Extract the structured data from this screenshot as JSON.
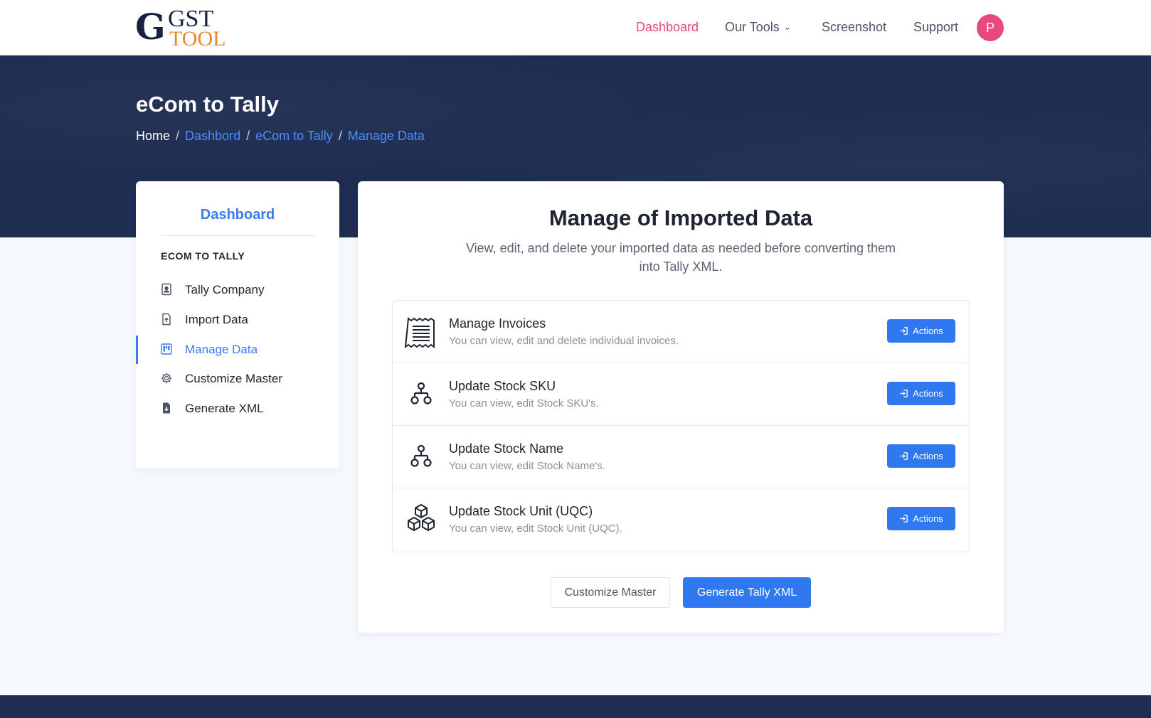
{
  "brand": {
    "logo_mark": "G",
    "logo_top": "GST",
    "logo_bottom": "TOOL"
  },
  "nav": {
    "dashboard": "Dashboard",
    "our_tools": "Our Tools",
    "screenshot": "Screenshot",
    "support": "Support",
    "avatar_initial": "P"
  },
  "hero": {
    "title": "eCom to Tally",
    "breadcrumb": [
      "Home",
      "Dashbord",
      "eCom to Tally",
      "Manage Data"
    ]
  },
  "sidebar": {
    "title": "Dashboard",
    "section": "ECOM TO TALLY",
    "items": [
      {
        "label": "Tally Company",
        "icon": "id-card-icon"
      },
      {
        "label": "Import Data",
        "icon": "file-upload-icon"
      },
      {
        "label": "Manage Data",
        "icon": "kanban-icon",
        "active": true
      },
      {
        "label": "Customize Master",
        "icon": "gear-icon"
      },
      {
        "label": "Generate XML",
        "icon": "file-download-icon"
      }
    ]
  },
  "main": {
    "title": "Manage of Imported Data",
    "subtitle": "View, edit, and delete your imported data as needed before converting them into Tally XML.",
    "rows": [
      {
        "title": "Manage Invoices",
        "desc": "You can view, edit and delete individual invoices.",
        "action": "Actions",
        "icon": "receipt-icon"
      },
      {
        "title": "Update Stock SKU",
        "desc": "You can view, edit Stock SKU's.",
        "action": "Actions",
        "icon": "hierarchy-icon"
      },
      {
        "title": "Update Stock Name",
        "desc": "You can view, edit Stock Name's.",
        "action": "Actions",
        "icon": "hierarchy-icon"
      },
      {
        "title": "Update Stock Unit (UQC)",
        "desc": "You can view, edit Stock Unit (UQC).",
        "action": "Actions",
        "icon": "boxes-icon"
      }
    ],
    "customize_button": "Customize Master",
    "generate_button": "Generate Tally XML"
  },
  "colors": {
    "accent": "#2f78f0",
    "nav_active": "#e8487c",
    "hero_bg": "#1f2d52",
    "link": "#4d8dff"
  }
}
